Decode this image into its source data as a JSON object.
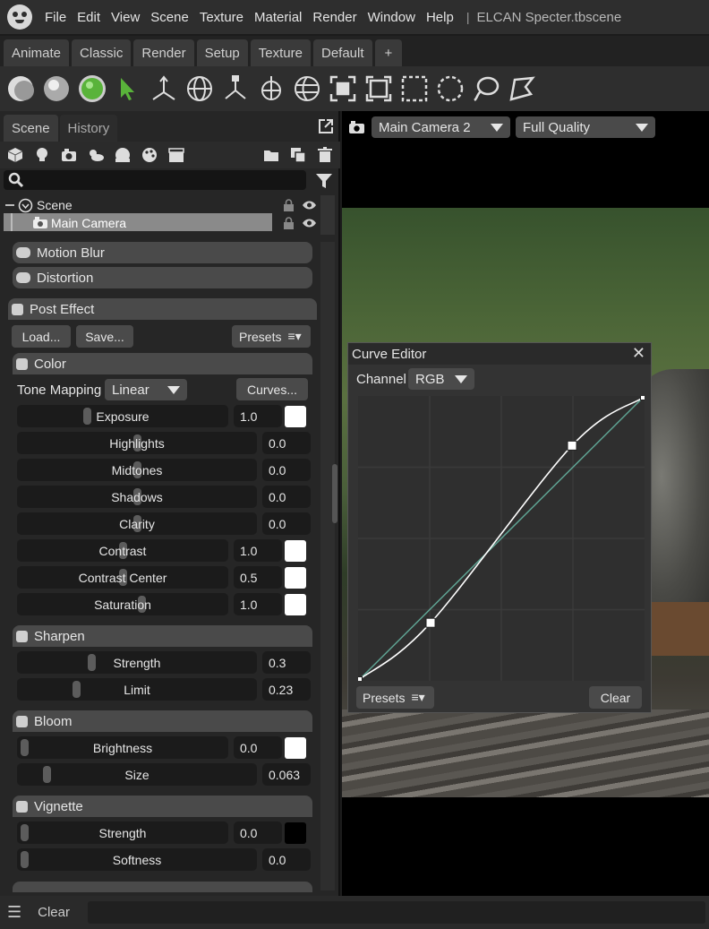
{
  "menubar": {
    "items": [
      "File",
      "Edit",
      "View",
      "Scene",
      "Texture",
      "Material",
      "Render",
      "Window",
      "Help"
    ],
    "separator": "|",
    "doc_title": "ELCAN Specter.tbscene"
  },
  "layout_tabs": [
    "Animate",
    "Classic",
    "Render",
    "Setup",
    "Texture",
    "Default",
    "+"
  ],
  "toolbar_icons": [
    "shaded-sphere-icon",
    "glossy-sphere-icon",
    "material-sphere-icon",
    "select-arrow-icon",
    "move-axes-icon",
    "rotate-globe-icon",
    "scale-axes-icon",
    "transform-icon",
    "world-globe-icon",
    "frame-selected-icon",
    "frame-all-icon",
    "rect-select-icon",
    "circle-select-icon",
    "lasso-select-icon",
    "paint-select-icon"
  ],
  "panel_tabs": {
    "scene": "Scene",
    "history": "History"
  },
  "scene_tree": {
    "root": "Scene",
    "child": "Main Camera"
  },
  "viewport": {
    "camera": "Main Camera 2",
    "quality": "Full Quality"
  },
  "sections": {
    "motion_blur": "Motion Blur",
    "distortion": "Distortion",
    "post_effect": "Post Effect",
    "color": "Color",
    "sharpen": "Sharpen",
    "bloom": "Bloom",
    "vignette": "Vignette"
  },
  "post_effect": {
    "load": "Load...",
    "save": "Save...",
    "presets": "Presets"
  },
  "color": {
    "tone_mapping_label": "Tone Mapping",
    "tone_mapping_value": "Linear",
    "curves_button": "Curves...",
    "exposure": {
      "label": "Exposure",
      "value": "1.0",
      "level": 0.32
    },
    "highlights": {
      "label": "Highlights",
      "value": "0.0",
      "level": 0.5
    },
    "midtones": {
      "label": "Midtones",
      "value": "0.0",
      "level": 0.5
    },
    "shadows": {
      "label": "Shadows",
      "value": "0.0",
      "level": 0.5
    },
    "clarity": {
      "label": "Clarity",
      "value": "0.0",
      "level": 0.5
    },
    "contrast": {
      "label": "Contrast",
      "value": "1.0",
      "level": 0.5
    },
    "contrast_center": {
      "label": "Contrast Center",
      "value": "0.5",
      "level": 0.5
    },
    "saturation": {
      "label": "Saturation",
      "value": "1.0",
      "level": 0.6
    }
  },
  "sharpen": {
    "strength": {
      "label": "Strength",
      "value": "0.3",
      "level": 0.3
    },
    "limit": {
      "label": "Limit",
      "value": "0.23",
      "level": 0.23
    }
  },
  "bloom": {
    "brightness": {
      "label": "Brightness",
      "value": "0.0",
      "level": 0.0
    },
    "size": {
      "label": "Size",
      "value": "0.063",
      "level": 0.1
    }
  },
  "vignette": {
    "strength": {
      "label": "Strength",
      "value": "0.0",
      "level": 0.0
    },
    "softness": {
      "label": "Softness",
      "value": "0.0",
      "level": 0.0
    }
  },
  "colors": {
    "swatch_white": "#ffffff",
    "swatch_black": "#000000",
    "accent_green": "#59b33a",
    "curve_line": "#ffffff",
    "diagonal_line": "#5fa393"
  },
  "curve_editor": {
    "title": "Curve Editor",
    "channel_label": "Channel",
    "channel_value": "RGB",
    "presets": "Presets",
    "clear": "Clear",
    "points": [
      [
        0.0,
        0.0
      ],
      [
        0.25,
        0.2
      ],
      [
        0.75,
        0.83
      ],
      [
        1.0,
        1.0
      ]
    ]
  },
  "statusbar": {
    "clear": "Clear"
  }
}
